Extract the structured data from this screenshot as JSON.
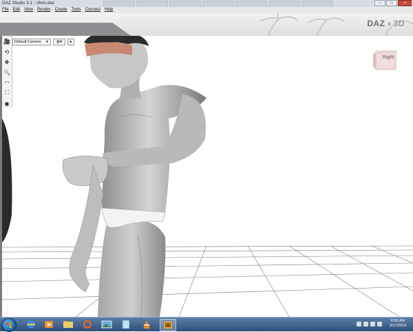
{
  "window": {
    "title": "DAZ Studio 3.1 - cfnm.daz",
    "buttons": {
      "minimize": "–",
      "maximize": "□",
      "close": "×"
    }
  },
  "menu": [
    "File",
    "Edit",
    "View",
    "Render",
    "Create",
    "Tools",
    "Connect",
    "Help"
  ],
  "logo": {
    "daz": "DAZ",
    "three_d": "3D"
  },
  "viewport": {
    "camera": "Default Camera",
    "draw_style_icon": "sphere-shading-icon",
    "cube_label": "Right"
  },
  "tools": [
    {
      "name": "camera-tool-icon",
      "glyph": "🎥"
    },
    {
      "name": "rotate-tool-icon",
      "glyph": "⟲"
    },
    {
      "name": "translate-tool-icon",
      "glyph": "✥"
    },
    {
      "name": "zoom-tool-icon",
      "glyph": "🔍"
    },
    {
      "name": "orbit-tool-icon",
      "glyph": "◠"
    },
    {
      "name": "frame-tool-icon",
      "glyph": "⛶"
    },
    {
      "name": "aim-tool-icon",
      "glyph": "◉"
    }
  ],
  "taskbar": {
    "apps": [
      "ie-icon",
      "media-player-icon",
      "explorer-icon",
      "firefox-icon",
      "photo-icon",
      "notepad-icon",
      "vlc-icon",
      "daz-studio-icon"
    ],
    "time": "8:55 AM",
    "date": "3/17/2013"
  },
  "colors": {
    "accent": "#2d4f77",
    "band": "#8d8f93",
    "skin": "#c6c6c6",
    "brief": "#f2f2f2"
  }
}
